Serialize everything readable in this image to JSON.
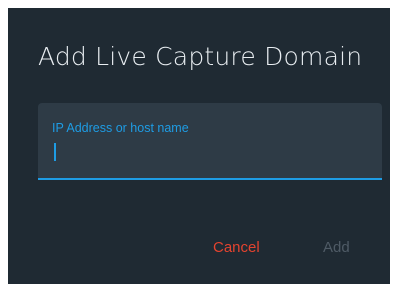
{
  "dialog": {
    "title": "Add Live Capture Domain",
    "field": {
      "label": "IP Address or host name",
      "value": ""
    },
    "buttons": {
      "cancel_label": "Cancel",
      "add_label": "Add"
    },
    "colors": {
      "background": "#1f2a33",
      "field_background": "#2e3b46",
      "accent": "#1e9ce4",
      "cancel": "#e2432f",
      "disabled": "#4f5b66"
    }
  }
}
